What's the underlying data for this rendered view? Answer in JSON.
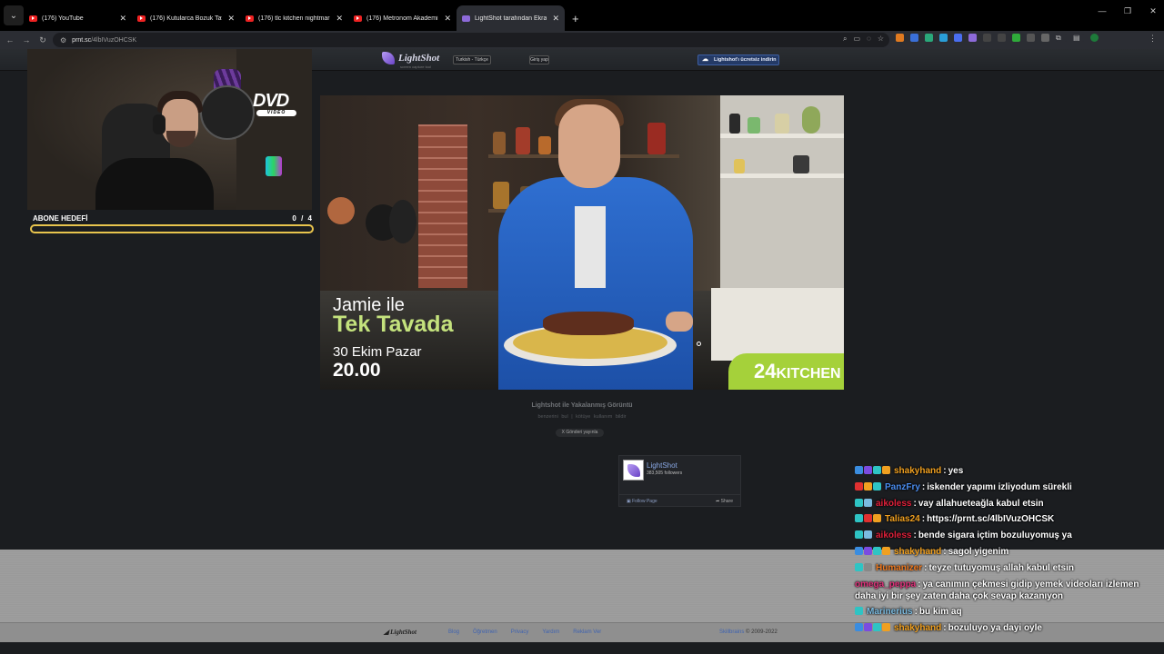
{
  "browser": {
    "tabs": [
      {
        "title": "(176) YouTube",
        "kind": "yt"
      },
      {
        "title": "(176) Kutularca Bozuk Tavuk Ç...",
        "kind": "yt"
      },
      {
        "title": "(176) tlc kitchen nightmares - Y...",
        "kind": "yt"
      },
      {
        "title": "(176) Metronom Akademi | 1. B...",
        "kind": "yt"
      },
      {
        "title": "LightShot tarafından Ekran Gör...",
        "kind": "ls"
      }
    ],
    "url_host": "prnt.sc",
    "url_path": "/4lbIVuzOHCSK"
  },
  "lightshot": {
    "logo": "LightShot",
    "logo_sub": "screen capture tool",
    "language": "Turkish - Türkçe",
    "login": "Giriş yap",
    "download": "Lightshot'ı ücretsiz indirin",
    "caption": "Lightshot ile Yakalanmış Görüntü",
    "meta": "benzerini bul    |    kötüye kullanım bildir",
    "tweet": "X Gönderi yayınla",
    "fb_name": "LightShot",
    "fb_followers": "383,505 followers",
    "fb_follow": "Follow Page",
    "fb_share": "Share",
    "footer_logo": "LightShot",
    "footer_links": [
      "Blog",
      "Öğretmen",
      "Privacy",
      "Yardım",
      "Reklam Ver"
    ],
    "footer_company": "Skillbrains",
    "footer_years": "© 2009-2022"
  },
  "ad": {
    "line1": "Jamie ile",
    "line2": "Tek Tavada",
    "line3": "30 Ekim Pazar",
    "line4": "20.00",
    "channel_num": "24",
    "channel_name": "KITCHEN"
  },
  "webcam": {
    "dvd": "DVD",
    "dvd_sub": "VIDEO"
  },
  "goal": {
    "label": "ABONE HEDEFİ",
    "count": "0 / 4",
    "progress": 0
  },
  "chat": [
    {
      "badges": [
        "#3a8de0",
        "#7b4be0",
        "#2ec4c4",
        "#f0a020"
      ],
      "user": "shakyhand",
      "color": "#f0a020",
      "text": "yes"
    },
    {
      "badges": [
        "#e03030",
        "#f0a020",
        "#2ec4c4"
      ],
      "user": "PanzFry",
      "color": "#4a8df0",
      "text": "iskender yapımı izliyodum sürekli"
    },
    {
      "badges": [
        "#2ec4c4",
        "#7bbbe0"
      ],
      "user": "aikoless",
      "color": "#e0203a",
      "text": "vay allahueteağla kabul etsin"
    },
    {
      "badges": [
        "#2ec4c4",
        "#e03030",
        "#f0a020"
      ],
      "user": "Talias24",
      "color": "#f0a020",
      "text": "https://prnt.sc/4lbIVuzOHCSK"
    },
    {
      "badges": [
        "#2ec4c4",
        "#7bbbe0"
      ],
      "user": "aikoless",
      "color": "#e0203a",
      "text": "bende sigara içtim bozuluyomuş ya"
    },
    {
      "badges": [
        "#3a8de0",
        "#7b4be0",
        "#2ec4c4",
        "#f0a020"
      ],
      "user": "shakyhand",
      "color": "#f0a020",
      "text": "sagol yigenim"
    },
    {
      "badges": [
        "#2ec4c4",
        "#888888"
      ],
      "user": "Humanizer",
      "color": "#f07a20",
      "text": "teyze tutuyomuş allah kabul etsin"
    },
    {
      "badges": [],
      "user": "omega_peppa",
      "color": "#e0307a",
      "text": "ya canımın çekmesi gidip yemek videoları izlemen daha iyi bir şey zaten daha çok sevap kazanıyon"
    },
    {
      "badges": [
        "#2ec4c4"
      ],
      "user": "Marinerius",
      "color": "#7bbbe0",
      "text": "bu kim aq"
    },
    {
      "badges": [
        "#3a8de0",
        "#7b4be0",
        "#2ec4c4",
        "#f0a020"
      ],
      "user": "shakyhand",
      "color": "#f0a020",
      "text": "bozuluyo ya dayi oyle"
    }
  ]
}
